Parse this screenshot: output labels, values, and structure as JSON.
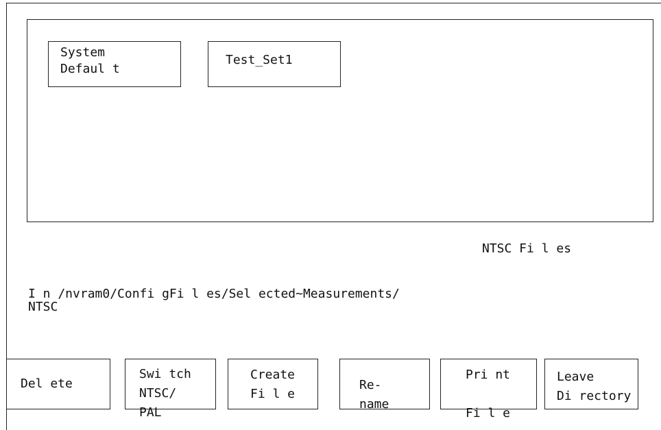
{
  "files": [
    {
      "label": "System\nDefaul t"
    },
    {
      "label": "Test_Set1"
    }
  ],
  "files_heading": "NTSC Fi l es",
  "path": "I n /nvram0/Confi gFi l es/Sel ected~Measurements/\nNTSC",
  "softkeys": {
    "delete": "Del ete",
    "switch": "Swi tch\nNTSC/\nPAL",
    "create": "Create\nFi l e",
    "rename": "Re-\nname",
    "print": "Pri nt\n\nFi l e",
    "leave": "Leave\nDi rectory"
  }
}
